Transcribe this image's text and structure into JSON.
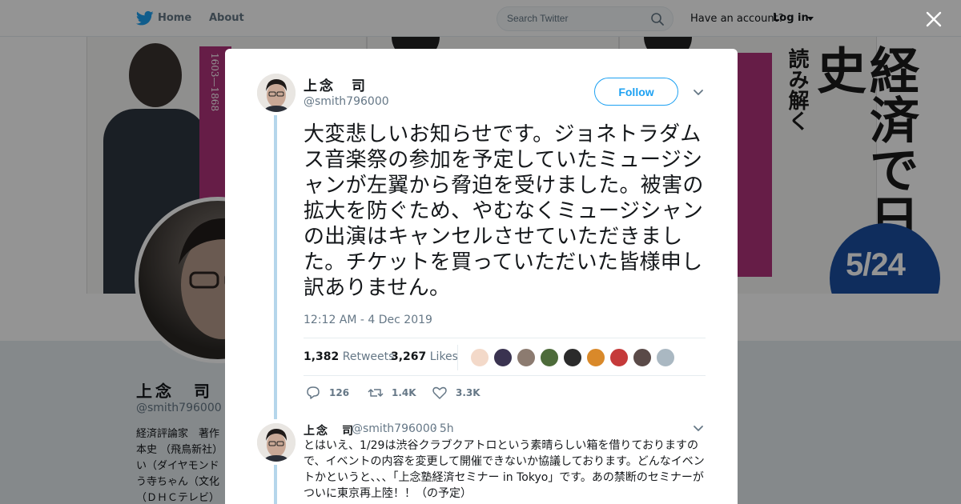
{
  "topbar": {
    "home_label": "Home",
    "about_label": "About",
    "search_placeholder": "Search Twitter",
    "have_account": "Have an account?",
    "login_label": "Log in"
  },
  "banner": {
    "panel1_years": "1603—1868",
    "panel3_title": "経済で日本史",
    "panel3_subtitle": "読み解く",
    "panel3_date": "5/24"
  },
  "profile": {
    "name": "上念　司",
    "handle": "@smith796000",
    "bio": "経済評論家　著作\n本史 （飛鳥新社）\nい（ダイヤモンド\nう寺ちゃん（文化\n（ＤＨＣテレビ）"
  },
  "tweet": {
    "author_name": "上念　司",
    "author_handle": "@smith796000",
    "follow_label": "Follow",
    "text": "大変悲しいお知らせです。ジョネトラダムス音楽祭の参加を予定していたミュージシャンが左翼から脅迫を受けました。被害の拡大を防ぐため、やむなくミュージシャンの出演はキャンセルさせていただきました。チケットを買っていただいた皆様申し訳ありません。",
    "timestamp": "12:12 AM - 4 Dec 2019",
    "retweets_count": "1,382",
    "retweets_label": "Retweets",
    "likes_count": "3,267",
    "likes_label": "Likes",
    "reply_count": "126",
    "retweet_action_count": "1.4K",
    "like_action_count": "3.3K",
    "likers": [
      "#f3d9c9",
      "#3a3350",
      "#8c7b70",
      "#4d6b3a",
      "#2b2b2b",
      "#d9892a",
      "#c53a3a",
      "#5a4a48",
      "#aab8c2"
    ]
  },
  "reply": {
    "author_name": "上念　司",
    "author_handle": "@smith796000",
    "time": "· 5h",
    "text": "とはいえ、1/29は渋谷クラブクアトロという素晴らしい箱を借りておりますので、イベントの内容を変更して開催できないか協議しております。どんなイベントかというと、、、「上念塾経済セミナー in Tokyo」です。あの禁断のセミナーがついに東京再上陸！！（の予定）"
  },
  "colors": {
    "twitter_blue": "#1da1f2",
    "thread_line": "#b5d6eb",
    "secondary_text": "#657786",
    "book_magenta": "#b0327a",
    "date_circle": "#1b4fa0"
  },
  "icons": [
    "twitter-bird-icon",
    "search-icon",
    "close-icon",
    "chevron-down-icon",
    "reply-icon",
    "retweet-icon",
    "like-icon"
  ]
}
